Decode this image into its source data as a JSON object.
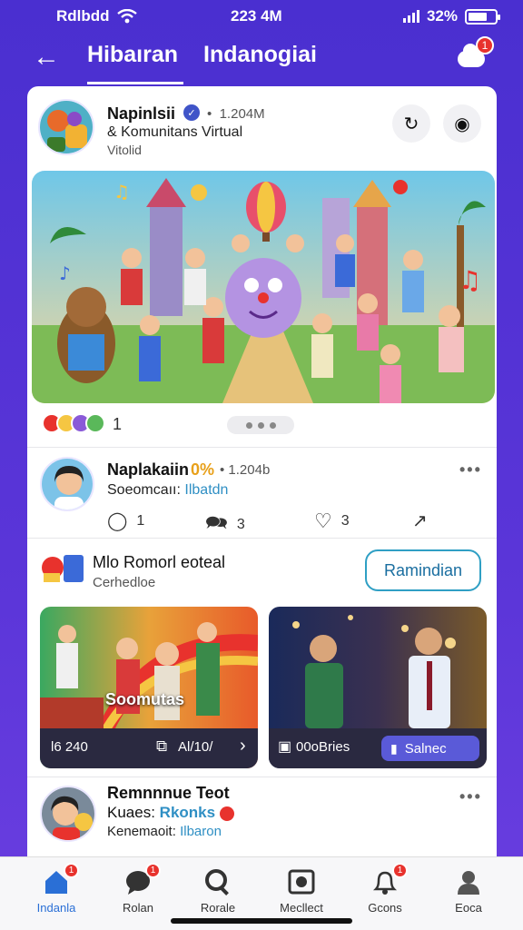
{
  "status": {
    "carrier": "Rdlbdd",
    "time": "223 4M",
    "battery": "32%"
  },
  "header": {
    "tab_active": "Hibaıran",
    "tab_other": "Indanogiai",
    "notif_count": "1"
  },
  "post1": {
    "title": "Napinlsii",
    "meta": "1.204M",
    "subtitle": "& Komunitans  Virtual",
    "tag": "Vitolid",
    "reaction_count": "1"
  },
  "post2": {
    "title": "Naplakaiin",
    "badge": "0%",
    "meta": "1.204b",
    "subtitle_prefix": "Soeomcaıı:",
    "subtitle_link": "Ilbatdn",
    "comments": "1",
    "messages": "3",
    "likes": "3"
  },
  "section": {
    "title": "Mlo Romorl eoteal",
    "subtitle": "Cerhedloe",
    "remind_label": "Ramindian"
  },
  "thumb1": {
    "overlay_title": "Soomutas",
    "left_text": "l6 240",
    "right_text": "Al/10/"
  },
  "thumb2": {
    "left_text": "00oBries",
    "button_label": "Salnec"
  },
  "post3": {
    "title": "Remnnnue Teot",
    "line2_prefix": "Kuaes:",
    "line2_link": "Rkonks",
    "line3_prefix": "Kenemaoit:",
    "line3_link": "Ilbaron"
  },
  "nav": [
    {
      "label": "Indanla",
      "badge": "1"
    },
    {
      "label": "Rolan",
      "badge": "1"
    },
    {
      "label": "Rorale",
      "badge": ""
    },
    {
      "label": "Mecllect",
      "badge": ""
    },
    {
      "label": "Gcons",
      "badge": "1"
    },
    {
      "label": "Eoca",
      "badge": ""
    }
  ],
  "colors": {
    "brand": "#4a2fd0",
    "accent": "#2f9fc4",
    "badge": "#e8322d",
    "active_nav": "#2a6fd6"
  }
}
